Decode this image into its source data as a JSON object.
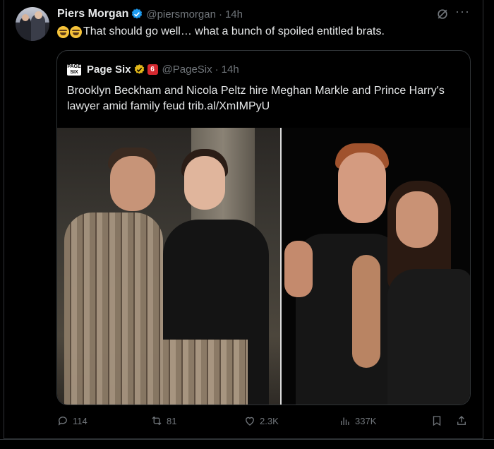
{
  "tweet": {
    "author_name": "Piers Morgan",
    "handle": "@piersmorgan",
    "separator": "·",
    "time": "14h",
    "text": "That should go well… what a bunch of spoiled entitled brats.",
    "emoji": [
      "rolling-on-floor-laughing",
      "rolling-on-floor-laughing"
    ]
  },
  "quote": {
    "logo_text": "Page Six",
    "author_name": "Page Six",
    "handle": "@PageSix",
    "separator": "·",
    "time": "14h",
    "text": "Brooklyn Beckham and Nicola Peltz hire Meghan Markle and Prince Harry's lawyer amid family feud trib.al/XmIMPyU"
  },
  "actions": {
    "replies": "114",
    "reposts": "81",
    "likes": "2.3K",
    "views": "337K"
  },
  "colors": {
    "background": "#000000",
    "text": "#e7e9ea",
    "muted": "#71767b",
    "border": "#2f3336",
    "verified_blue": "#1d9bf0",
    "verified_gold": "#e2b719"
  }
}
